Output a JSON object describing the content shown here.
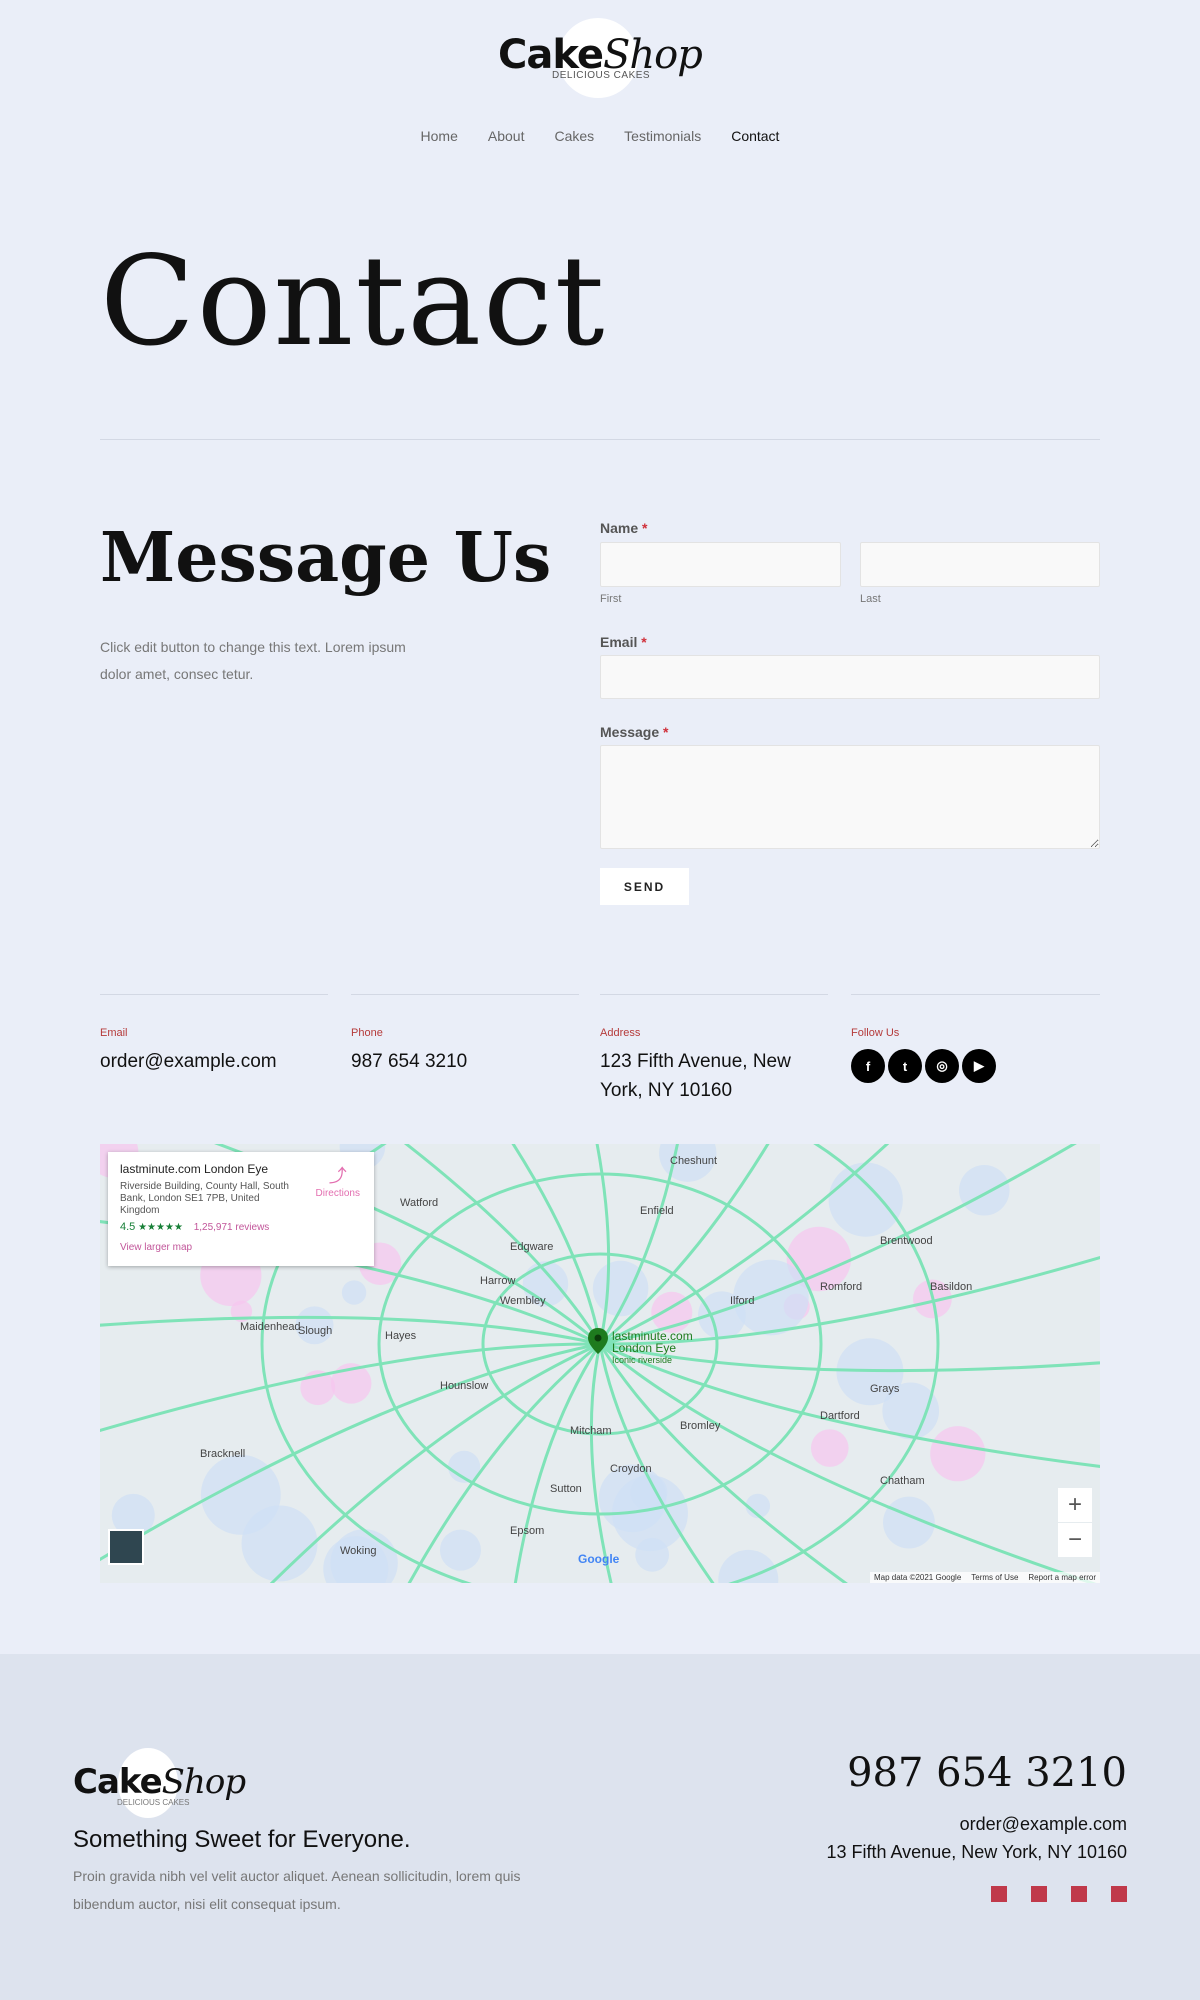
{
  "header": {
    "logo_main": "Cake",
    "logo_script": "Shop",
    "logo_tag": "DELICIOUS CAKES",
    "nav": [
      "Home",
      "About",
      "Cakes",
      "Testimonials",
      "Contact"
    ],
    "active": "Contact"
  },
  "page_title": "Contact",
  "message": {
    "heading": "Message Us",
    "intro": "Click edit button to change this text. Lorem ipsum dolor amet, consec tetur."
  },
  "form": {
    "name_label": "Name",
    "first_label": "First",
    "last_label": "Last",
    "email_label": "Email",
    "message_label": "Message",
    "required_mark": "*",
    "send_label": "SEND"
  },
  "info": [
    {
      "label": "Email",
      "value": "order@example.com"
    },
    {
      "label": "Phone",
      "value": "987 654 3210"
    },
    {
      "label": "Address",
      "value": "123 Fifth Avenue, New York, NY 10160"
    },
    {
      "label": "Follow Us"
    }
  ],
  "social_icons": [
    "facebook-icon",
    "twitter-icon",
    "instagram-icon",
    "youtube-icon"
  ],
  "map": {
    "place": "lastminute.com London Eye",
    "address": "Riverside Building, County Hall, South Bank, London SE1 7PB, United Kingdom",
    "rating": "4.5",
    "stars": "★★★★★",
    "reviews": "1,25,971 reviews",
    "directions": "Directions",
    "larger": "View larger map",
    "pin_label": "lastminute.com London Eye",
    "pin_sub": "Iconic riverside",
    "attribution": "Map data ©2021 Google",
    "terms": "Terms of Use",
    "report": "Report a map error",
    "google": "Google",
    "labels": [
      "Watford",
      "Enfield",
      "Cheshunt",
      "Edgware",
      "Harrow",
      "Wembley",
      "Romford",
      "Ilford",
      "Brentwood",
      "Basildon",
      "Slough",
      "Hayes",
      "Hounslow",
      "Mitcham",
      "Croydon",
      "Bromley",
      "Dartford",
      "Sutton",
      "Epsom",
      "Woking",
      "Chatham",
      "Grays",
      "Maidenhead",
      "Bracknell"
    ]
  },
  "footer": {
    "tagline": "Something Sweet for Everyone.",
    "text": "Proin gravida nibh vel velit auctor aliquet. Aenean sollicitudin, lorem quis bibendum auctor, nisi elit consequat ipsum.",
    "phone": "987 654 3210",
    "email": "order@example.com",
    "address": "13 Fifth Avenue, New York, NY 10160"
  },
  "colors": {
    "background": "#eaeef8",
    "footer": "#dde3ee",
    "accent": "#b53a3a"
  }
}
